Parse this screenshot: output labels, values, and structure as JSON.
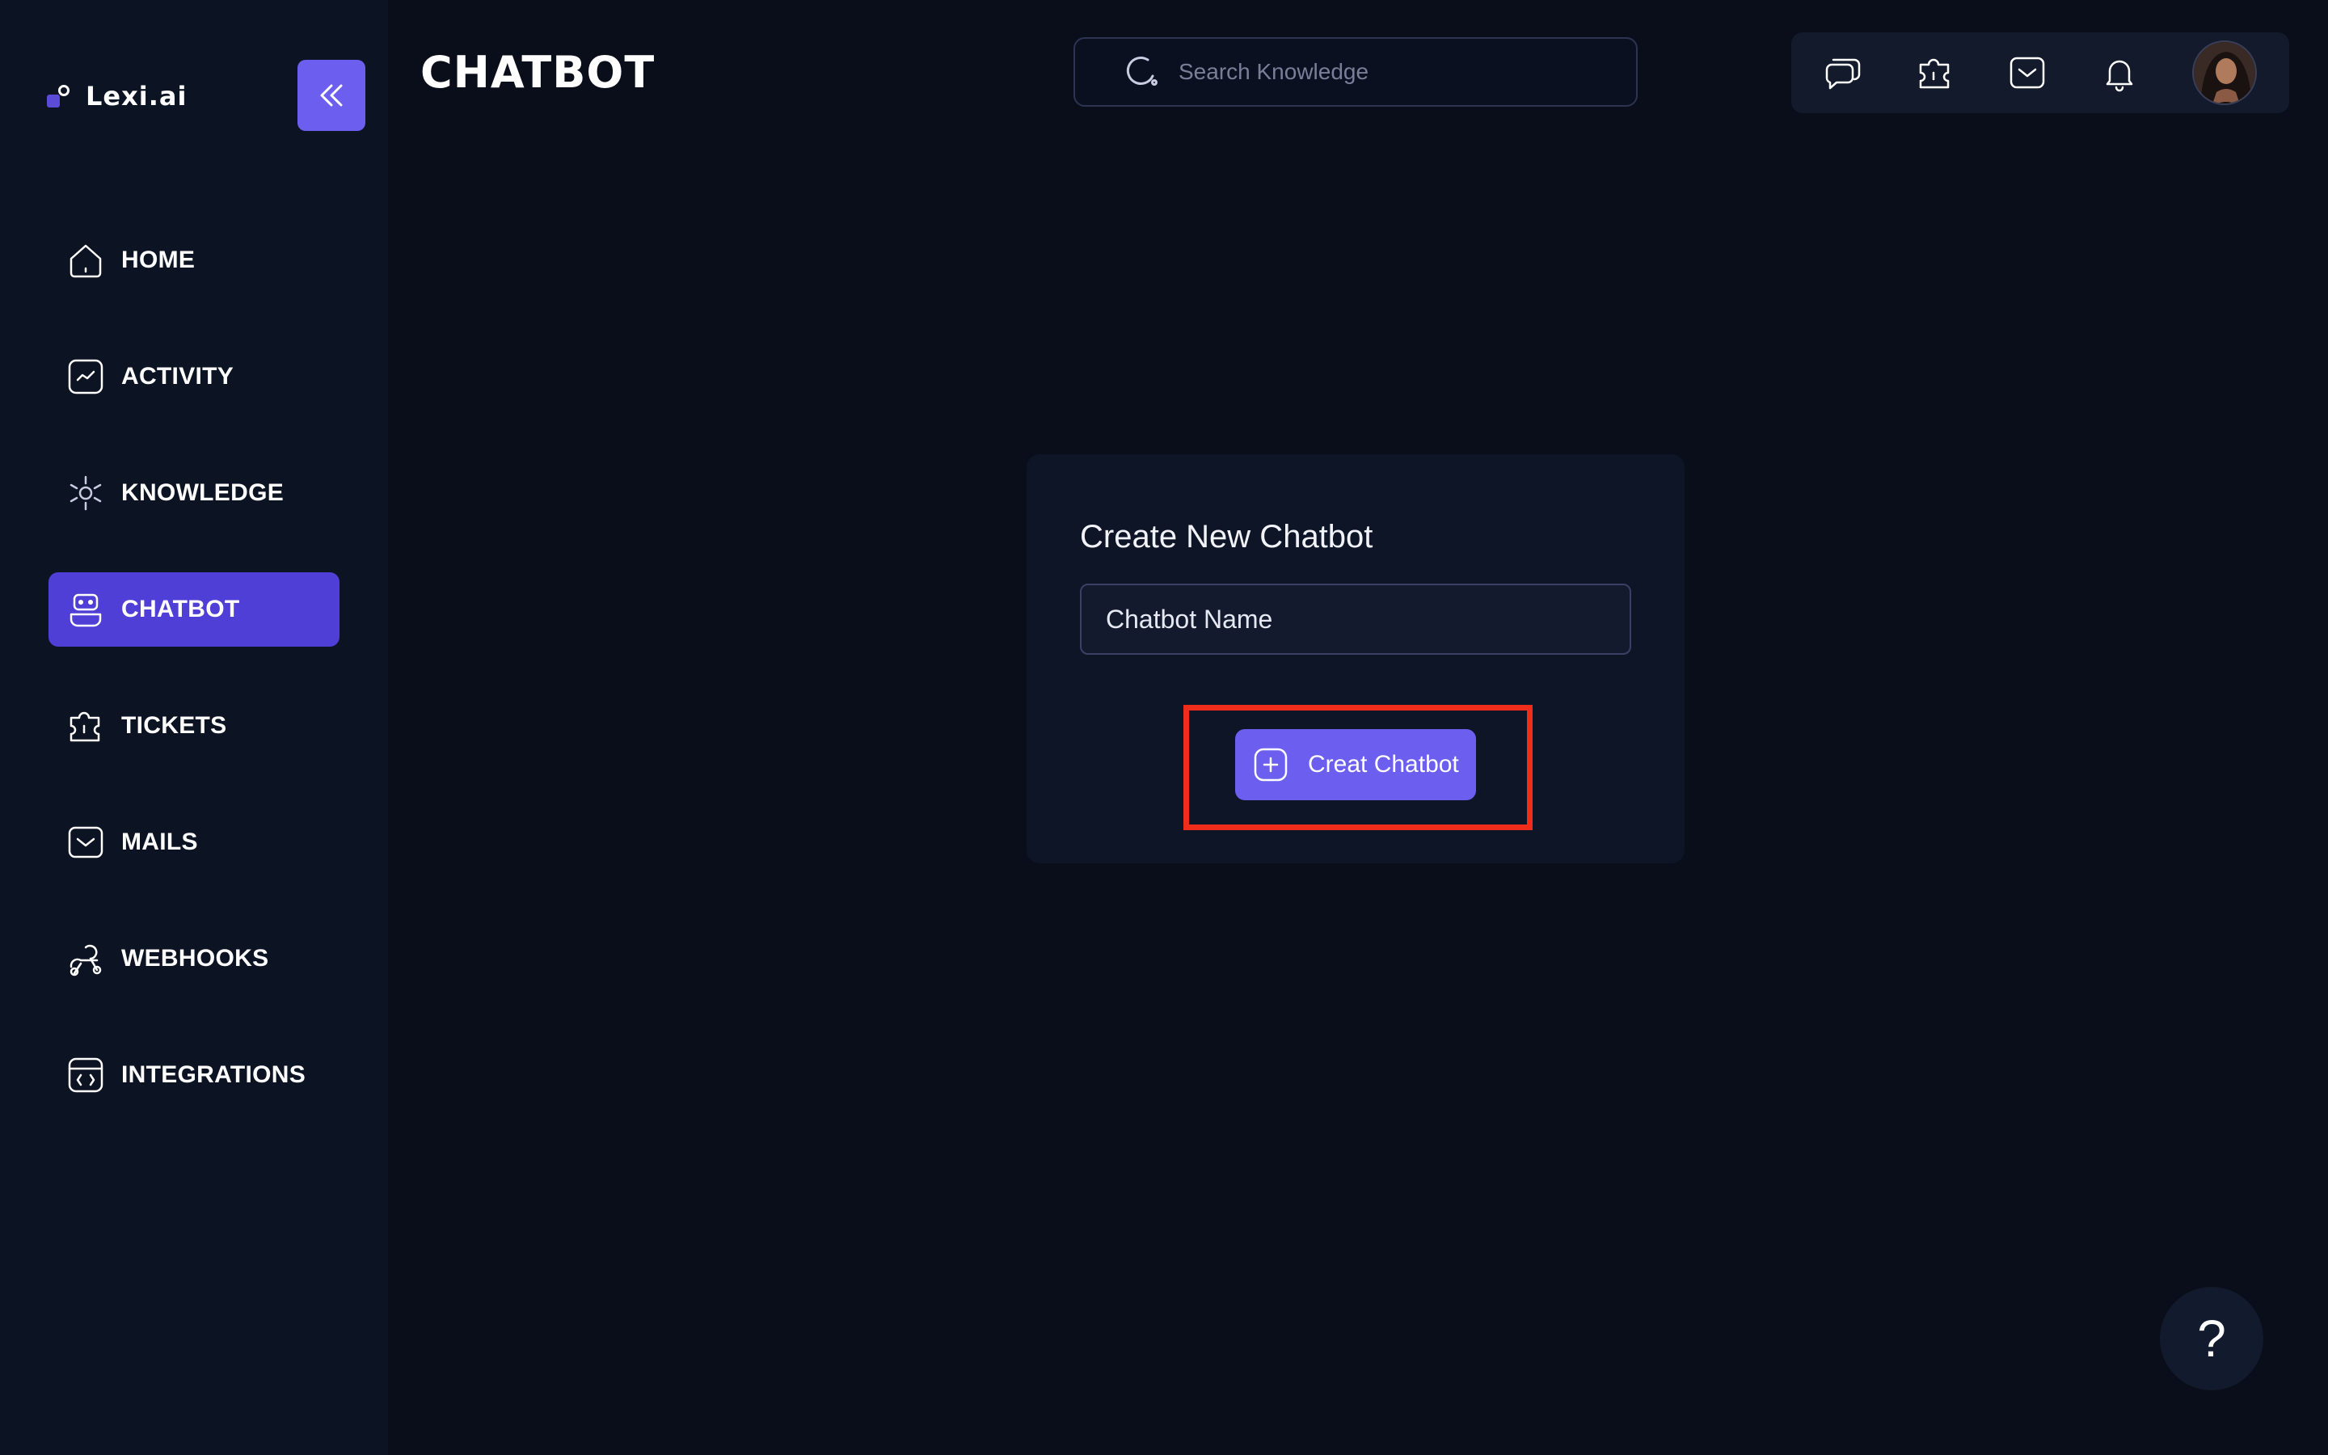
{
  "brand": {
    "name": "Lexi.ai"
  },
  "header": {
    "title": "CHATBOT",
    "search_placeholder": "Search Knowledge",
    "icons": [
      "chat-icon",
      "ticket-icon",
      "mail-icon",
      "bell-icon"
    ]
  },
  "sidebar": {
    "items": [
      {
        "label": "HOME",
        "icon": "home-icon",
        "active": false
      },
      {
        "label": "ACTIVITY",
        "icon": "activity-icon",
        "active": false
      },
      {
        "label": "KNOWLEDGE",
        "icon": "knowledge-icon",
        "active": false
      },
      {
        "label": "CHATBOT",
        "icon": "robot-icon",
        "active": true
      },
      {
        "label": "TICKETS",
        "icon": "ticket-icon",
        "active": false
      },
      {
        "label": "MAILS",
        "icon": "mail-icon",
        "active": false
      },
      {
        "label": "WEBHOOKS",
        "icon": "webhook-icon",
        "active": false
      },
      {
        "label": "INTEGRATIONS",
        "icon": "code-icon",
        "active": false
      }
    ]
  },
  "card": {
    "title": "Create New Chatbot",
    "input_placeholder": "Chatbot Name",
    "button_label": "Creat Chatbot"
  },
  "help": {
    "label": "?"
  },
  "colors": {
    "accent": "#6c5ff0",
    "active_nav": "#4f3fd6",
    "background": "#0a0e1a",
    "sidebar": "#0c1322",
    "highlight": "#f02c1a"
  }
}
